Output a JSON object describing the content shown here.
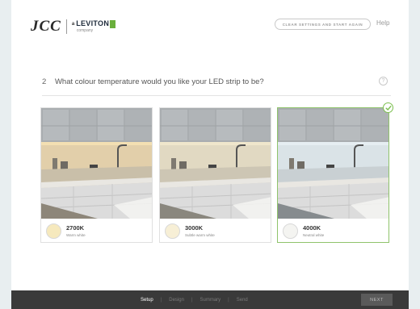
{
  "header": {
    "logo_jcc": "JCC",
    "logo_leviton": "LEVITON",
    "logo_leviton_prefix": "a",
    "logo_leviton_sub": "company",
    "clear_button": "CLEAR SETTINGS AND START AGAIN",
    "help_link": "Help"
  },
  "question": {
    "number": "2",
    "text": "What colour temperature would you like your LED strip to be?",
    "help_icon": "?"
  },
  "options": [
    {
      "temp": "2700K",
      "desc": "Warm white",
      "swatch": "#f6e9bd",
      "selected": false
    },
    {
      "temp": "3000K",
      "desc": "Subtle warm white",
      "swatch": "#f7efd6",
      "selected": false
    },
    {
      "temp": "4000K",
      "desc": "Neutral white",
      "swatch": "#f4f4f1",
      "selected": true
    }
  ],
  "footer": {
    "steps": [
      {
        "label": "Setup",
        "active": true
      },
      {
        "label": "Design",
        "active": false
      },
      {
        "label": "Summary",
        "active": false
      },
      {
        "label": "Send",
        "active": false
      }
    ],
    "separator": "|",
    "next_button": "NEXT"
  },
  "colors": {
    "accent_green": "#7bbf4e",
    "footer_bg": "#3a3a3a"
  }
}
